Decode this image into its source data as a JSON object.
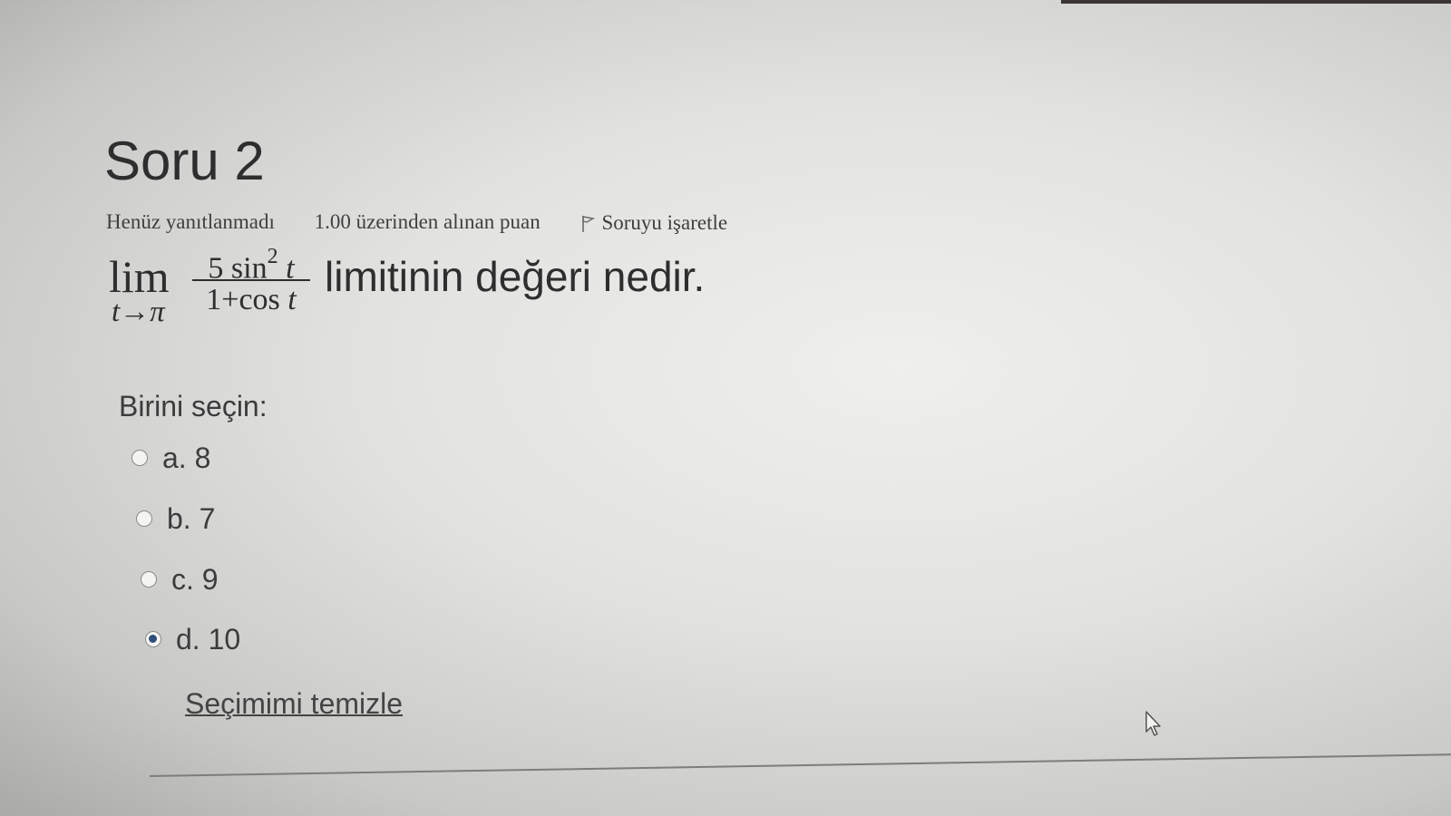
{
  "question": {
    "title": "Soru 2",
    "state": "Henüz yanıtlanmadı",
    "grade": "1.00 üzerinden alınan puan",
    "flag_label": "Soruyu işaretle",
    "flag_icon": "flag-icon",
    "formula": {
      "lim": "lim",
      "subscript": "t→π",
      "numerator_coef": "5 sin",
      "numerator_exp": "2",
      "numerator_var": "t",
      "denominator_prefix": "1+cos",
      "denominator_var": "t"
    },
    "stem_text": "limitinin değeri nedir."
  },
  "answer_block": {
    "prompt": "Birini seçin:",
    "options": [
      {
        "label": "a. 8",
        "selected": false
      },
      {
        "label": "b. 7",
        "selected": false
      },
      {
        "label": "c. 9",
        "selected": false
      },
      {
        "label": "d. 10",
        "selected": true
      }
    ],
    "clear_label": "Seçimimi temizle"
  },
  "colors": {
    "radio_selected": "#2f4f7a",
    "text": "#3c3c3c"
  }
}
